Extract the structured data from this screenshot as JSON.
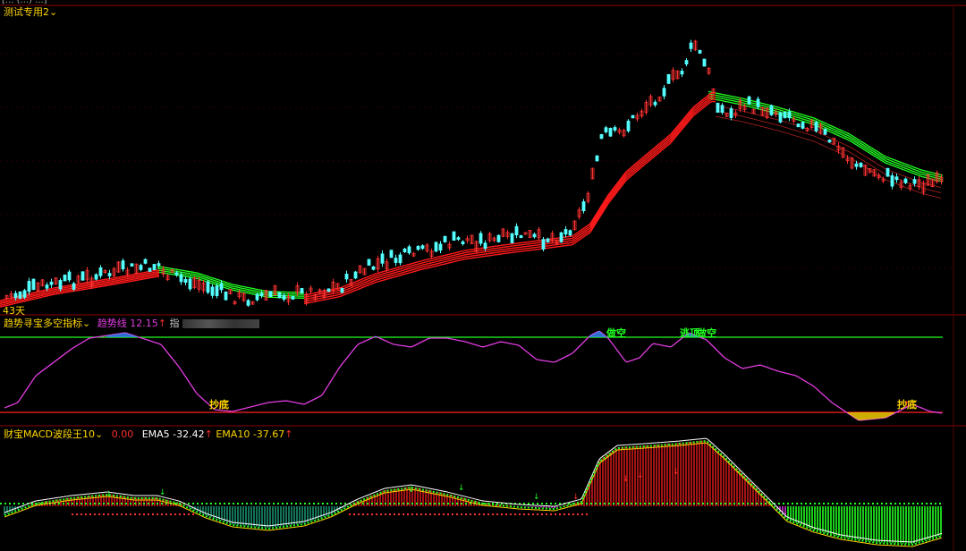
{
  "top_line": "[... (...) ...]",
  "main_panel": {
    "indicator_name": "测试专用2",
    "bottom_label": "43天",
    "colors": {
      "up": "#ff3232",
      "down": "#54ffff",
      "ma_red": "#ff1a1a",
      "ma_green": "#22ff22",
      "frame": "#8b0000"
    }
  },
  "panel2": {
    "title": "趋势寻宝多空指标",
    "value_label": "趋势线",
    "value": "12.15",
    "value_arrow": "↑",
    "trailing": "指",
    "signals": {
      "bottom1": "抄底",
      "bottom2": "抄底",
      "short1": "做空",
      "short2": "做空",
      "short_mark": "逃顶"
    },
    "colors": {
      "line": "#e03ce0",
      "upper": "#22ff22",
      "lower": "#ff2020"
    }
  },
  "panel3": {
    "title": "财宝MACD波段王10",
    "v0": "0.00",
    "ema5_label": "EMA5",
    "ema5_value": "-32.42",
    "ema5_arrow": "↑",
    "ema10_label": "EMA10",
    "ema10_value": "-37.67",
    "ema10_arrow": "↑",
    "colors": {
      "pos": "#ff2020",
      "neg": "#22c0c0",
      "green": "#22ff22",
      "purple": "#cc33cc"
    }
  }
}
